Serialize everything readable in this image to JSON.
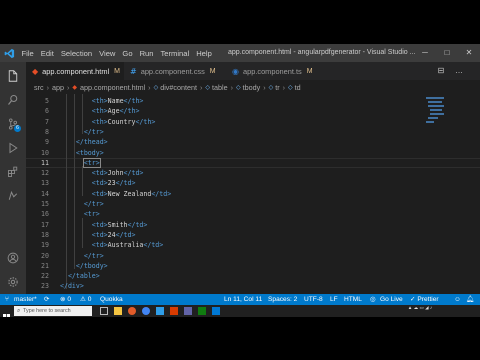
{
  "app": {
    "menu": [
      "File",
      "Edit",
      "Selection",
      "View",
      "Go",
      "Run",
      "Terminal",
      "Help"
    ],
    "window_title": "app.component.html - angularpdfgenerator - Visual Studio ...",
    "window_controls": {
      "minimize": "─",
      "maximize": "□",
      "close": "✕"
    }
  },
  "tabs": [
    {
      "label": "app.component.html",
      "modified": "M",
      "icon": "html-icon",
      "color": "#e44d26"
    },
    {
      "label": "app.component.css",
      "modified": "M",
      "icon": "css-icon",
      "color": "#42a5f5"
    },
    {
      "label": "app.component.ts",
      "modified": "M",
      "icon": "ts-icon",
      "color": "#3178c6"
    }
  ],
  "tab_actions": {
    "split": "⊟",
    "more": "…"
  },
  "breadcrumb": [
    "src",
    "app",
    "app.component.html",
    "div#content",
    "table",
    "tbody",
    "tr",
    "td"
  ],
  "editor": {
    "current_line": 11,
    "lines": [
      {
        "n": 5,
        "indent": "        ",
        "parts": [
          [
            "tag",
            "<th>"
          ],
          [
            "txt",
            "Name"
          ],
          [
            "tag",
            "</th>"
          ]
        ]
      },
      {
        "n": 6,
        "indent": "        ",
        "parts": [
          [
            "tag",
            "<th>"
          ],
          [
            "txt",
            "Age"
          ],
          [
            "tag",
            "</th>"
          ]
        ]
      },
      {
        "n": 7,
        "indent": "        ",
        "parts": [
          [
            "tag",
            "<th>"
          ],
          [
            "txt",
            "Country"
          ],
          [
            "tag",
            "</th>"
          ]
        ]
      },
      {
        "n": 8,
        "indent": "      ",
        "parts": [
          [
            "tag",
            "</tr>"
          ]
        ]
      },
      {
        "n": 9,
        "indent": "    ",
        "parts": [
          [
            "tag",
            "</thead>"
          ]
        ]
      },
      {
        "n": 10,
        "indent": "    ",
        "parts": [
          [
            "tag",
            "<tbody>"
          ]
        ]
      },
      {
        "n": 11,
        "indent": "      ",
        "parts": [
          [
            "hl",
            "<tr>"
          ]
        ]
      },
      {
        "n": 12,
        "indent": "        ",
        "parts": [
          [
            "tag",
            "<td>"
          ],
          [
            "txt",
            "John"
          ],
          [
            "tag",
            "</td>"
          ]
        ]
      },
      {
        "n": 13,
        "indent": "        ",
        "parts": [
          [
            "tag",
            "<td>"
          ],
          [
            "txt",
            "23"
          ],
          [
            "tag",
            "</td>"
          ]
        ]
      },
      {
        "n": 14,
        "indent": "        ",
        "parts": [
          [
            "tag",
            "<td>"
          ],
          [
            "txt",
            "New Zealand"
          ],
          [
            "tag",
            "</td>"
          ]
        ]
      },
      {
        "n": 15,
        "indent": "      ",
        "parts": [
          [
            "tag",
            "</tr>"
          ]
        ]
      },
      {
        "n": 16,
        "indent": "      ",
        "parts": [
          [
            "tag",
            "<tr>"
          ]
        ]
      },
      {
        "n": 17,
        "indent": "        ",
        "parts": [
          [
            "tag",
            "<td>"
          ],
          [
            "txt",
            "Smith"
          ],
          [
            "tag",
            "</td>"
          ]
        ]
      },
      {
        "n": 18,
        "indent": "        ",
        "parts": [
          [
            "tag",
            "<td>"
          ],
          [
            "txt",
            "24"
          ],
          [
            "tag",
            "</td>"
          ]
        ]
      },
      {
        "n": 19,
        "indent": "        ",
        "parts": [
          [
            "tag",
            "<td>"
          ],
          [
            "txt",
            "Australia"
          ],
          [
            "tag",
            "</td>"
          ]
        ]
      },
      {
        "n": 20,
        "indent": "      ",
        "parts": [
          [
            "tag",
            "</tr>"
          ]
        ]
      },
      {
        "n": 21,
        "indent": "    ",
        "parts": [
          [
            "tag",
            "</tbody>"
          ]
        ]
      },
      {
        "n": 22,
        "indent": "  ",
        "parts": [
          [
            "tag",
            "</table>"
          ]
        ]
      },
      {
        "n": 23,
        "indent": "",
        "parts": [
          [
            "tag",
            "</div>"
          ]
        ]
      }
    ]
  },
  "status": {
    "branch": "master*",
    "sync": "⟳",
    "errors": "⊗ 0",
    "warnings": "⚠ 0",
    "quokka": "Quokka",
    "position": "Ln 11, Col 11",
    "spaces": "Spaces: 2",
    "encoding": "UTF-8",
    "eol": "LF",
    "language": "HTML",
    "golive": "Go Live",
    "prettier": "✓ Prettier",
    "colors": {
      "bar": "#007acc"
    }
  },
  "taskbar": {
    "search_placeholder": "Type here to search"
  },
  "colors": {
    "tag": "#569cd6",
    "text": "#d4d4d4",
    "accent": "#007acc",
    "editor_bg": "#1e1e1e"
  }
}
